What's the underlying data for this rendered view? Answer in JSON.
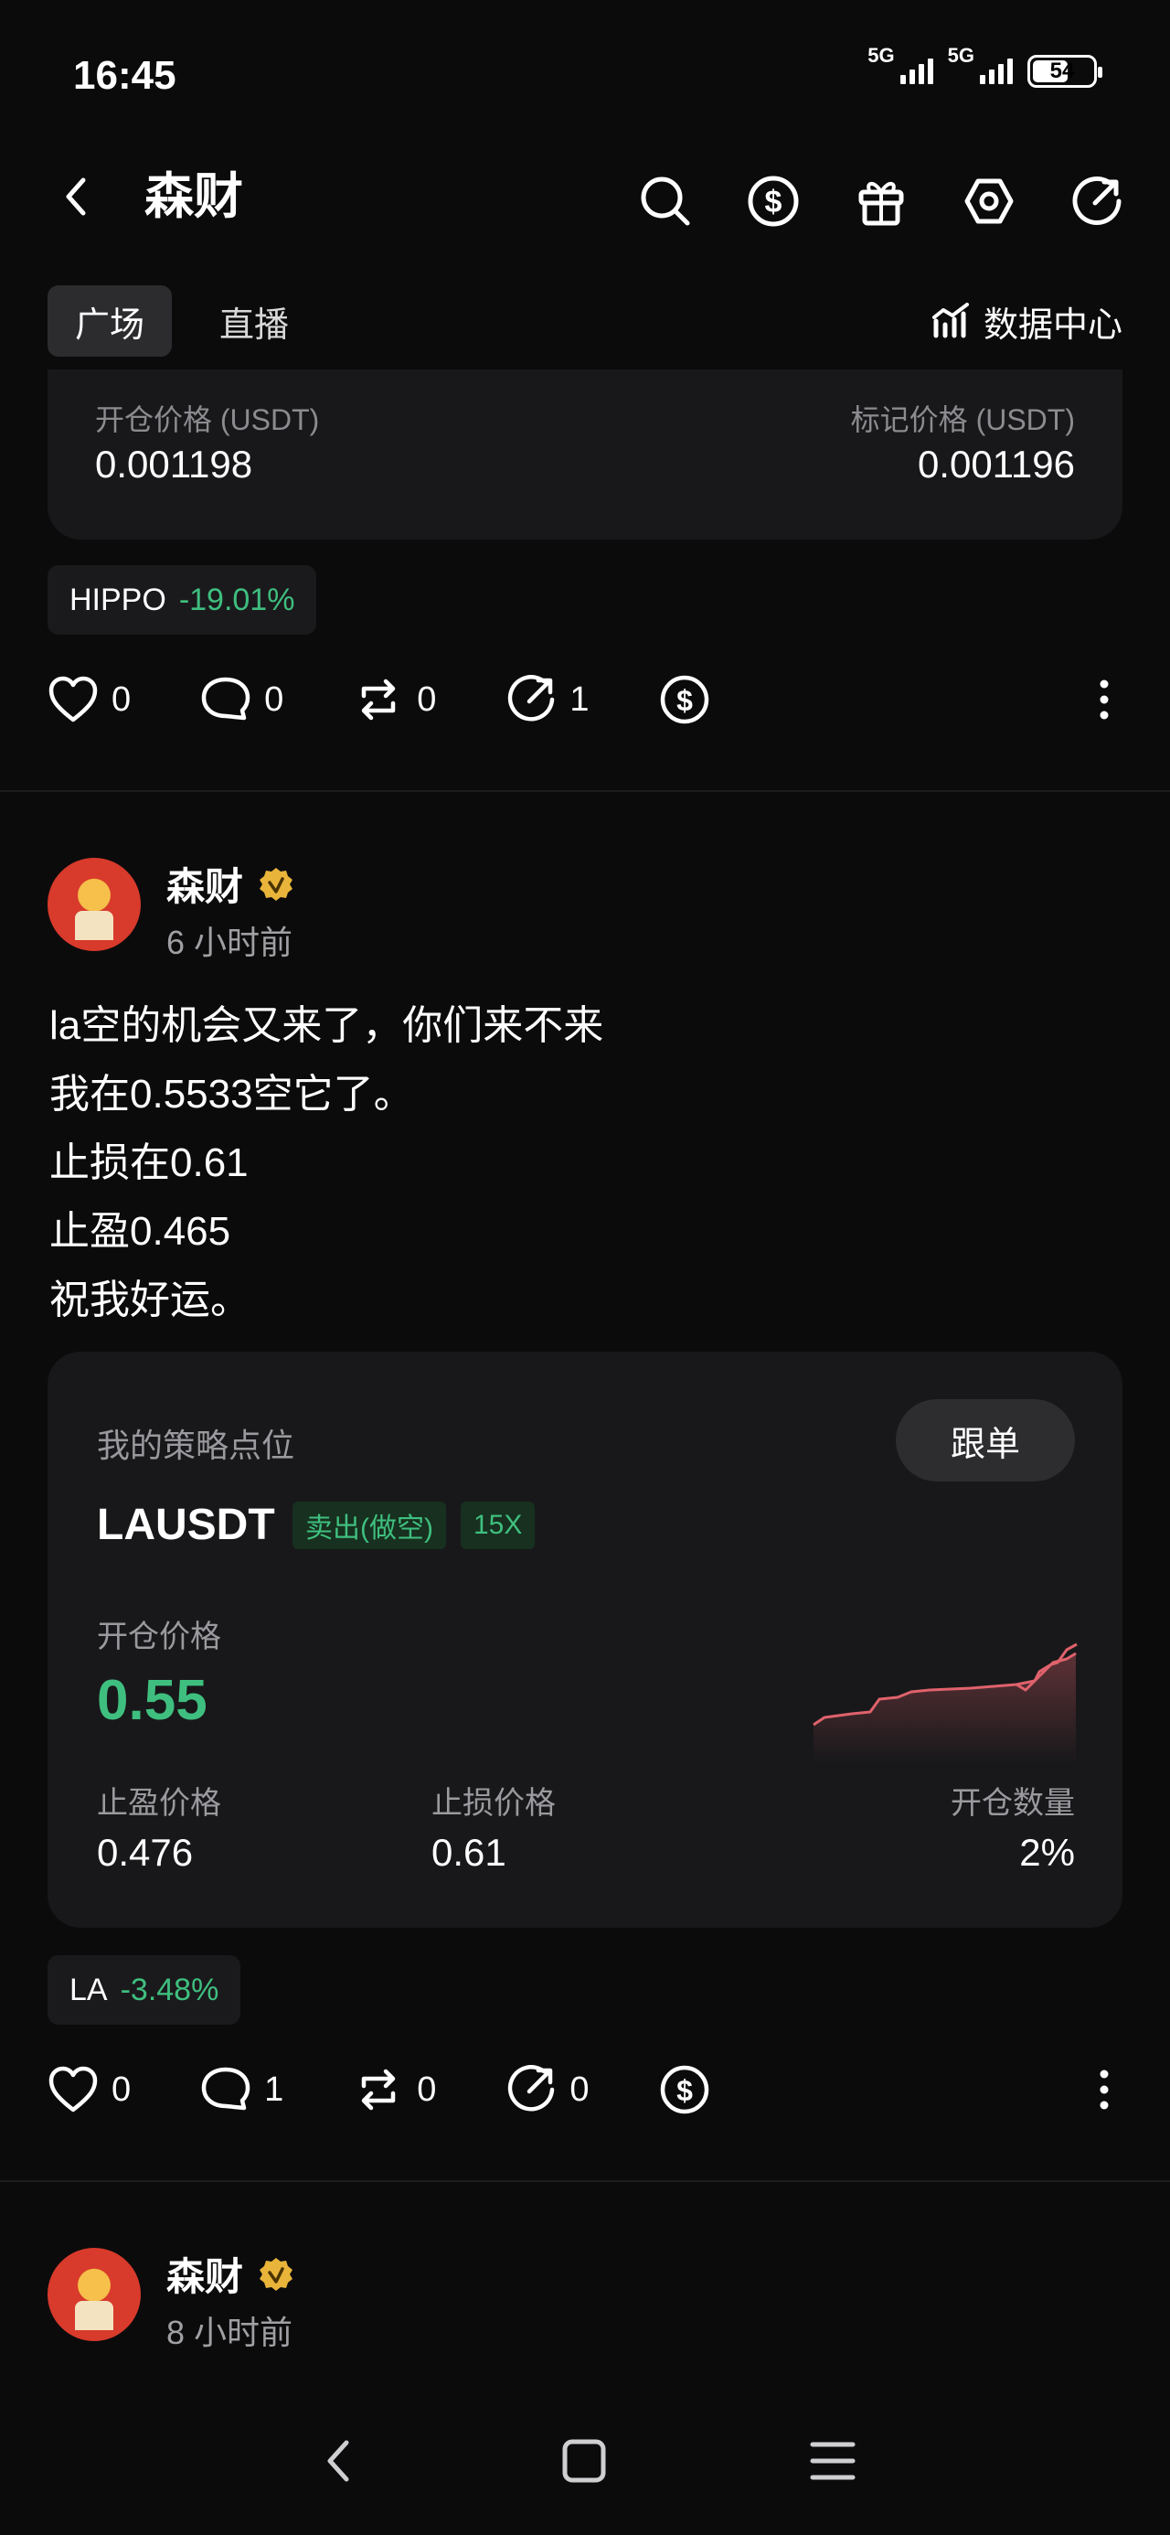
{
  "status_bar": {
    "time": "16:45",
    "network_1": "5G",
    "network_2": "5G",
    "battery": "54"
  },
  "header": {
    "title": "森财",
    "icons": [
      "back-icon",
      "search-icon",
      "dollar-coin-icon",
      "gift-icon",
      "settings-hexagon-icon",
      "share-icon"
    ]
  },
  "tabs": {
    "items": [
      {
        "label": "广场",
        "active": true
      },
      {
        "label": "直播",
        "active": false
      }
    ],
    "data_center": "数据中心"
  },
  "post_prev": {
    "open_price_label": "开仓价格 (USDT)",
    "open_price_value": "0.001198",
    "mark_price_label": "标记价格 (USDT)",
    "mark_price_value": "0.001196",
    "tag_name": "HIPPO",
    "tag_pct": "-19.01%",
    "likes": "0",
    "comments": "0",
    "reposts": "0",
    "shares": "1"
  },
  "post_main": {
    "author": "森财",
    "time": "6 小时前",
    "body_lines": [
      "la空的机会又来了，你们来不来",
      "我在0.5533空它了。",
      "止损在0.61",
      "止盈0.465",
      "祝我好运。"
    ],
    "strategy": {
      "title": "我的策略点位",
      "follow_label": "跟单",
      "symbol": "LAUSDT",
      "side": "卖出(做空)",
      "leverage": "15X",
      "open_price_label": "开仓价格",
      "open_price": "0.55",
      "tp_label": "止盈价格",
      "tp_value": "0.476",
      "sl_label": "止损价格",
      "sl_value": "0.61",
      "qty_label": "开仓数量",
      "qty_value": "2%",
      "spark_color": "#e0626c"
    },
    "tag_name": "LA",
    "tag_pct": "-3.48%",
    "likes": "0",
    "comments": "1",
    "reposts": "0",
    "shares": "0"
  },
  "post_next": {
    "author": "森财",
    "time": "8 小时前"
  },
  "colors": {
    "background": "#0b0b0c",
    "card": "#18181a",
    "green": "#3fbf7f",
    "verified": "#e9b43a"
  }
}
